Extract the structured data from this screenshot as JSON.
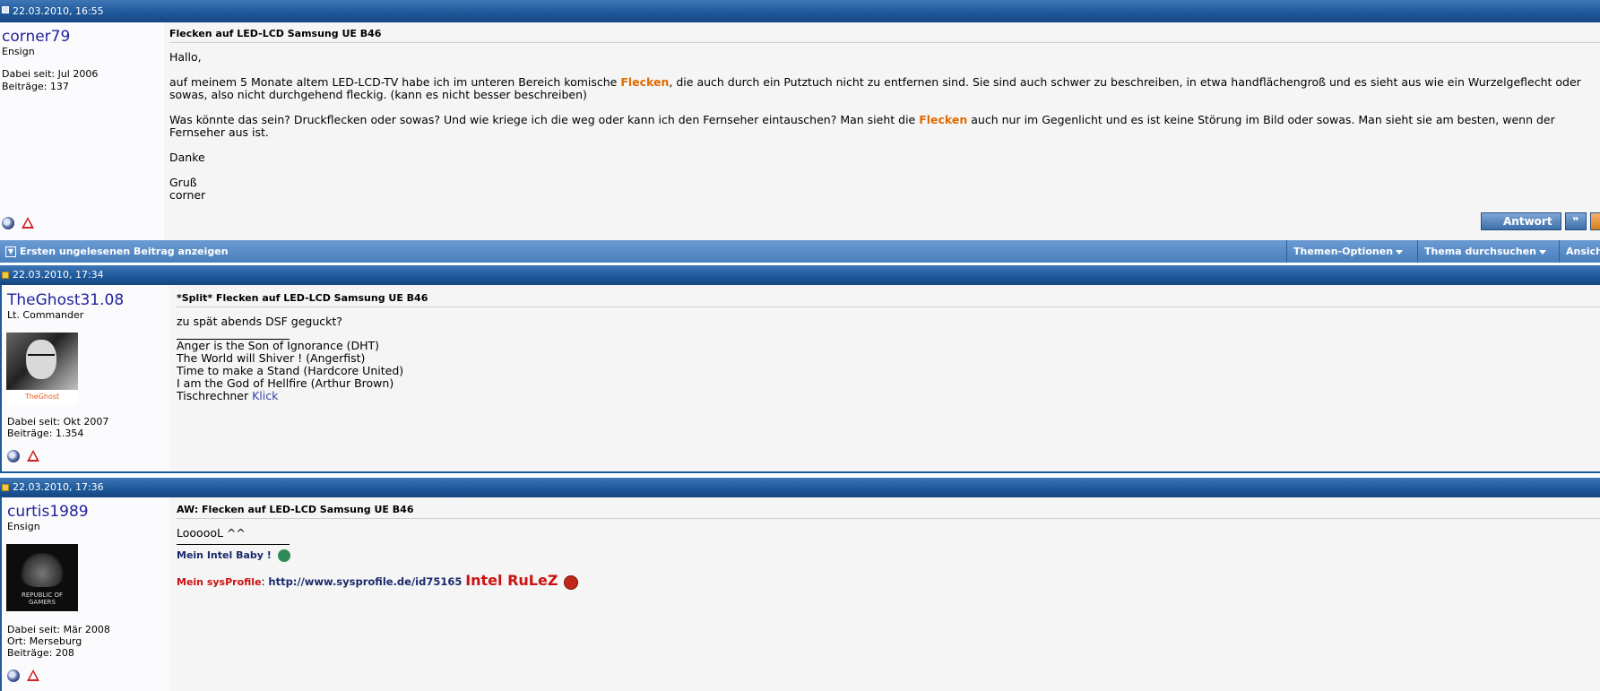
{
  "post1": {
    "date": "22.03.2010, 16:55",
    "username": "corner79",
    "rank": "Ensign",
    "joined": "Dabei seit: Jul 2006",
    "posts": "Beiträge: 137",
    "title": "Flecken auf LED-LCD Samsung UE B46",
    "greeting": "Hallo,",
    "para1_a": "auf meinem 5 Monate altem LED-LCD-TV habe ich im unteren Bereich komische ",
    "para1_hl": "Flecken",
    "para1_b": ", die auch durch ein Putztuch nicht zu entfernen sind. Sie sind auch schwer zu beschreiben, in etwa handflächengroß und es sieht aus wie ein Wurzelgeflecht oder sowas, also nicht durchgehend fleckig. (kann es nicht besser beschreiben)",
    "para2_a": "Was könnte das sein? Druckflecken oder sowas? Und wie kriege ich die weg oder kann ich den Fernseher eintauschen? Man sieht die ",
    "para2_hl": "Flecken",
    "para2_b": " auch nur im Gegenlicht und es ist keine Störung im Bild oder sowas. Man sieht sie am besten, wenn der Fernseher aus ist.",
    "thanks": "Danke",
    "closing1": "Gruß",
    "closing2": "corner",
    "reply_label": "Antwort"
  },
  "navbar": {
    "first_unread": "Ersten ungelesenen Beitrag anzeigen",
    "thread_options": "Themen-Optionen",
    "search_thread": "Thema durchsuchen",
    "view": "Ansich"
  },
  "post2": {
    "date": "22.03.2010, 17:34",
    "username": "TheGhost31.08",
    "rank": "Lt. Commander",
    "avatar_caption": "TheGhost",
    "joined": "Dabei seit: Okt 2007",
    "posts": "Beiträge: 1.354",
    "title": "*Split* Flecken auf LED-LCD Samsung UE B46",
    "text": "zu spät abends DSF geguckt?",
    "sig1": "Anger is the Son of Ignorance (DHT)",
    "sig2": "The World will Shiver ! (Angerfist)",
    "sig3": "Time to make a Stand (Hardcore United)",
    "sig4": "I am the God of Hellfire (Arthur Brown)",
    "sig5_a": "Tischrechner ",
    "sig5_link": "Klick"
  },
  "post3": {
    "date": "22.03.2010, 17:36",
    "username": "curtis1989",
    "rank": "Ensign",
    "avatar_text1": "REPUBLIC OF",
    "avatar_text2": "GAMERS",
    "joined": "Dabei seit: Mär 2008",
    "location": "Ort: Merseburg",
    "posts": "Beiträge: 208",
    "title": "AW: Flecken auf LED-LCD Samsung UE B46",
    "text": "LoooooL ^^",
    "sig_intel": "Mein Intel Baby !",
    "sig_sys_label": "Mein sysProfile",
    "sig_sys_colon": ": ",
    "sig_sys_url": "http://www.sysprofile.de/id75165",
    "sig_rulez": "Intel RuLeZ"
  },
  "colors": {
    "header_blue": "#1f5a9c",
    "highlight_orange": "#e06b00",
    "username_blue": "#22229c",
    "sig_red": "#cc1111"
  }
}
